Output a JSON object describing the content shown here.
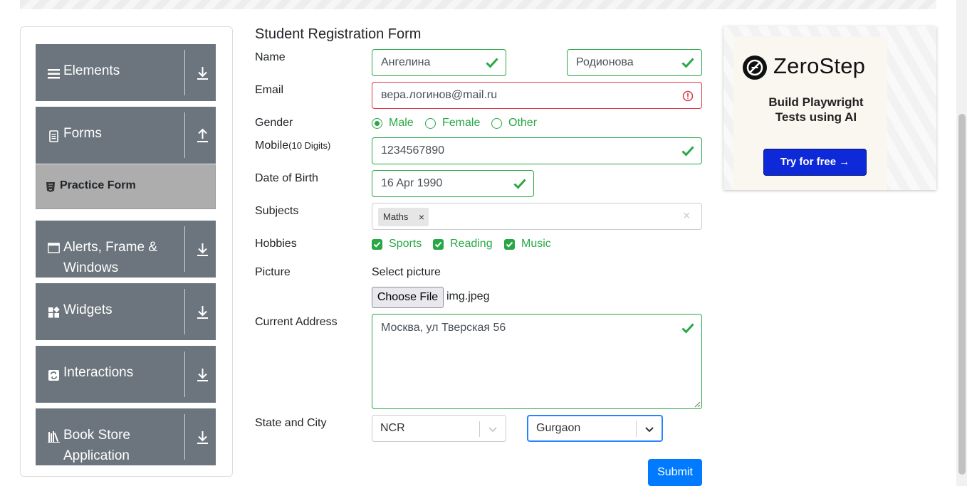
{
  "sidebar": {
    "groups": [
      {
        "label_line1": "Elements",
        "label_line2": "",
        "icon": "hamburger-icon",
        "arrow": "download-arrow"
      },
      {
        "label_line1": "Forms",
        "label_line2": "",
        "icon": "document-icon",
        "arrow": "upload-arrow"
      },
      {
        "label_line1": "Alerts, Frame &",
        "label_line2": "Windows",
        "icon": "window-icon",
        "arrow": "download-arrow"
      },
      {
        "label_line1": "Widgets",
        "label_line2": "",
        "icon": "widgets-icon",
        "arrow": "download-arrow"
      },
      {
        "label_line1": "Interactions",
        "label_line2": "",
        "icon": "interactions-icon",
        "arrow": "download-arrow"
      },
      {
        "label_line1": "Book Store",
        "label_line2": "Application",
        "icon": "bookstore-icon",
        "arrow": "download-arrow"
      }
    ],
    "active_item": {
      "label": "Practice Form",
      "icon": "html5-icon"
    }
  },
  "form": {
    "title": "Student Registration Form",
    "name_label": "Name",
    "first_name": "Ангелина",
    "last_name": "Родионова",
    "email_label": "Email",
    "email": "вера.логинов@mail.ru",
    "gender_label": "Gender",
    "gender_options": [
      "Male",
      "Female",
      "Other"
    ],
    "gender_selected": "Male",
    "mobile_label": "Mobile",
    "mobile_hint": "(10 Digits)",
    "mobile": "1234567890",
    "dob_label": "Date of Birth",
    "dob": "16 Apr 1990",
    "subjects_label": "Subjects",
    "subjects": [
      "Maths"
    ],
    "subject_remove": "×",
    "subjects_clear": "×",
    "hobbies_label": "Hobbies",
    "hobbies": [
      "Sports",
      "Reading",
      "Music"
    ],
    "picture_label": "Picture",
    "select_picture": "Select picture",
    "choose_file": "Choose File",
    "file_name": "img.jpeg",
    "address_label": "Current Address",
    "address": "Москва, ул Тверская 56",
    "state_city_label": "State and City",
    "state": "NCR",
    "city": "Gurgaon",
    "submit": "Submit"
  },
  "ad": {
    "brand": "ZeroStep",
    "tagline_line1": "Build Playwright",
    "tagline_line2": "Tests using AI",
    "cta": "Try for free →"
  },
  "colors": {
    "valid": "#28a745",
    "invalid": "#dc3545",
    "sidebar_bg": "#6c757d",
    "active_bg": "#adadad",
    "primary": "#007bff",
    "ad_cta": "#0d29d8"
  }
}
